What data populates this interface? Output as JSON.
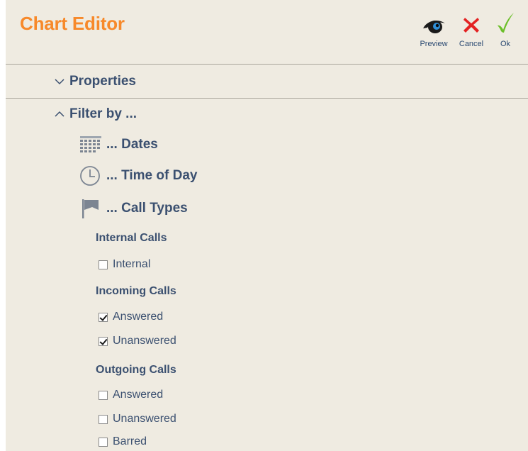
{
  "header": {
    "title": "Chart Editor",
    "buttons": {
      "preview": "Preview",
      "cancel": "Cancel",
      "ok": "Ok"
    }
  },
  "sections": {
    "properties": {
      "label": "Properties",
      "expanded": false
    },
    "filter": {
      "label": "Filter by ...",
      "expanded": true
    }
  },
  "filters": {
    "dates": {
      "label": "... Dates",
      "icon": "calendar-icon"
    },
    "time_of_day": {
      "label": "... Time of Day",
      "icon": "clock-icon"
    },
    "call_types": {
      "label": "... Call Types",
      "icon": "flag-icon"
    }
  },
  "call_groups": {
    "internal": {
      "label": "Internal Calls",
      "options": [
        {
          "label": "Internal",
          "checked": false
        }
      ]
    },
    "incoming": {
      "label": "Incoming Calls",
      "options": [
        {
          "label": "Answered",
          "checked": true
        },
        {
          "label": "Unanswered",
          "checked": true
        }
      ]
    },
    "outgoing": {
      "label": "Outgoing Calls",
      "options": [
        {
          "label": "Answered",
          "checked": false
        },
        {
          "label": "Unanswered",
          "checked": false
        },
        {
          "label": "Barred",
          "checked": false
        }
      ]
    }
  },
  "colors": {
    "accent": "#f7892a",
    "text": "#3b5070",
    "cancel": "#e32222",
    "ok": "#6cbf2a",
    "panel": "#efebe1"
  }
}
